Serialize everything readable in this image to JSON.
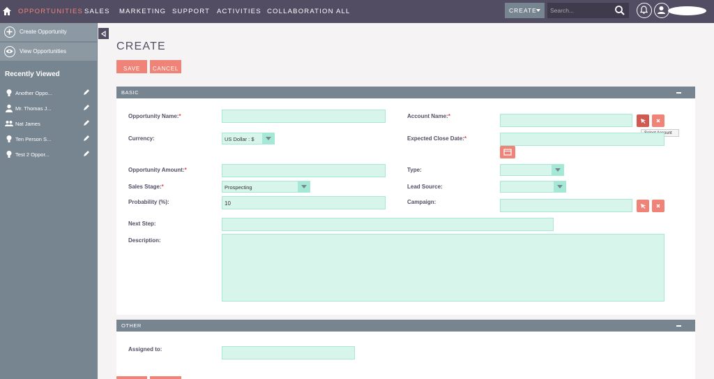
{
  "nav": {
    "items": [
      "OPPORTUNITIES",
      "SALES",
      "MARKETING",
      "SUPPORT",
      "ACTIVITIES",
      "COLLABORATION",
      "ALL"
    ],
    "create_label": "CREATE",
    "search_placeholder": "Search..."
  },
  "sidebar": {
    "actions": [
      "Create Opportunity",
      "View Opportunities"
    ],
    "recent_title": "Recently Viewed",
    "recent_items": [
      "Another Oppo...",
      "Mr. Thomas J...",
      "Nat James",
      "Ten Person S...",
      "Test 2 Oppor..."
    ]
  },
  "page": {
    "title": "CREATE",
    "save_label": "SAVE",
    "cancel_label": "CANCEL"
  },
  "basic": {
    "title": "BASIC",
    "opportunity_name_label": "Opportunity Name:",
    "currency_label": "Currency:",
    "currency_value": "US Dollar : $",
    "opportunity_amount_label": "Opportunity Amount:",
    "sales_stage_label": "Sales Stage:",
    "sales_stage_value": "Prospecting",
    "probability_label": "Probability (%):",
    "probability_value": "10",
    "next_step_label": "Next Step:",
    "description_label": "Description:",
    "account_name_label": "Account Name:",
    "expected_close_label": "Expected Close Date:",
    "type_label": "Type:",
    "lead_source_label": "Lead Source:",
    "campaign_label": "Campaign:",
    "tooltip": "Select Account",
    "required_mark": "*"
  },
  "other": {
    "title": "OTHER",
    "assigned_label": "Assigned to:"
  },
  "icons": {
    "home": "home-icon",
    "search": "search-icon",
    "bell": "bell-icon",
    "user": "user-icon",
    "select": "cursor-arrow-icon",
    "clear": "close-icon",
    "calendar": "calendar-icon"
  },
  "colors": {
    "topbar": "#534d64",
    "sidebar": "#778591",
    "accent": "#f08377",
    "field": "#d8f5ec",
    "required": "#e14545"
  }
}
